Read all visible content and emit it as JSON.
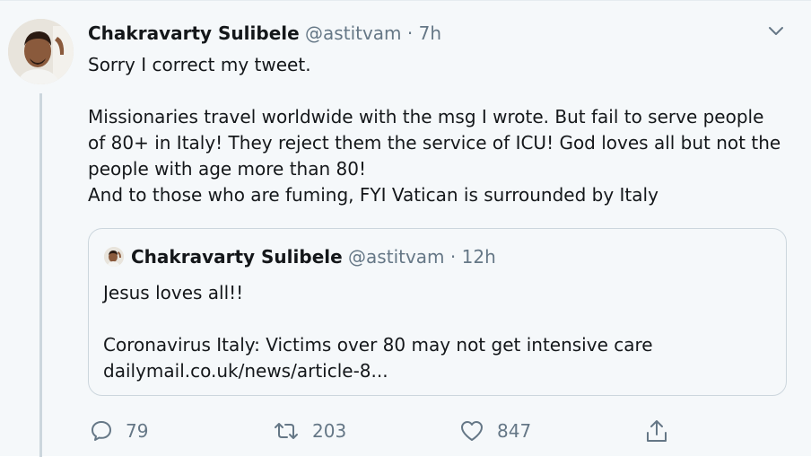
{
  "tweet": {
    "author_name": "Chakravarty Sulibele",
    "handle": "@astitvam",
    "separator": "·",
    "time": "7h",
    "text_lines": [
      "Sorry I correct my tweet.",
      "",
      "Missionaries travel worldwide with the msg I wrote. But fail to serve people",
      "of 80+ in Italy! They reject them the service of ICU! God loves all but not the",
      "people with age more than 80!",
      "And to those who are fuming, FYI Vatican is surrounded by Italy"
    ]
  },
  "quoted_tweet": {
    "author_name": "Chakravarty Sulibele",
    "handle": "@astitvam",
    "separator": "·",
    "time": "12h",
    "text_lines": [
      "Jesus loves all!!",
      "",
      "Coronavirus Italy: Victims over 80 may not get intensive care",
      "dailymail.co.uk/news/article-8..."
    ]
  },
  "actions": {
    "reply_icon": "speech-bubble-icon",
    "reply_count": "79",
    "retweet_icon": "retweet-arrows-icon",
    "retweet_count": "203",
    "like_icon": "heart-icon",
    "like_count": "847",
    "share_icon": "share-upload-icon"
  },
  "colors": {
    "background": "#f5f8fa",
    "text": "#14171a",
    "muted": "#657786",
    "border": "#ccd6dd"
  }
}
